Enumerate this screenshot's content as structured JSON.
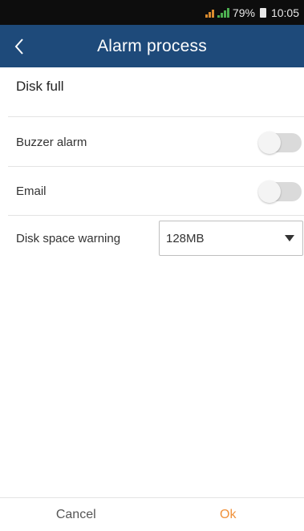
{
  "status_bar": {
    "battery_percent": "79%",
    "time": "10:05",
    "icons": [
      "signal-orange-icon",
      "signal-green-icon",
      "battery-icon"
    ]
  },
  "header": {
    "title": "Alarm process",
    "back_icon": "chevron-left-icon",
    "background_color": "#1e4a7a"
  },
  "section": {
    "title": "Disk full"
  },
  "settings": {
    "buzzer_alarm": {
      "label": "Buzzer alarm",
      "enabled": false
    },
    "email": {
      "label": "Email",
      "enabled": false
    },
    "disk_space_warning": {
      "label": "Disk space warning",
      "selected": "128MB"
    }
  },
  "footer": {
    "cancel_label": "Cancel",
    "ok_label": "Ok",
    "ok_color": "#f0913a"
  }
}
